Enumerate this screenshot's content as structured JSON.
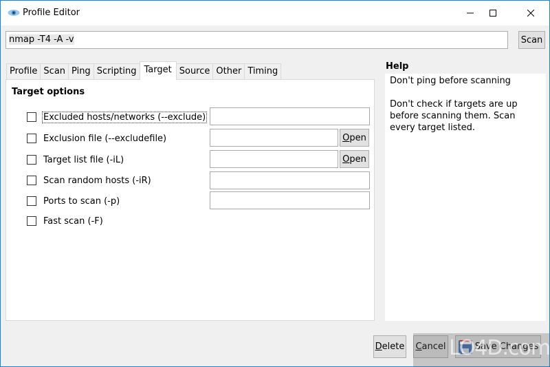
{
  "window": {
    "title": "Profile Editor",
    "controls": {
      "minimize": "minimize-icon",
      "maximize": "maximize-icon",
      "close": "close-icon"
    }
  },
  "command": {
    "value": "nmap -T4 -A -v",
    "scan_label": "Scan"
  },
  "tabs": [
    {
      "label": "Profile",
      "active": false
    },
    {
      "label": "Scan",
      "active": false
    },
    {
      "label": "Ping",
      "active": false
    },
    {
      "label": "Scripting",
      "active": false
    },
    {
      "label": "Target",
      "active": true
    },
    {
      "label": "Source",
      "active": false
    },
    {
      "label": "Other",
      "active": false
    },
    {
      "label": "Timing",
      "active": false
    }
  ],
  "target": {
    "section_title": "Target options",
    "options": [
      {
        "label": "Excluded hosts/networks (--exclude)",
        "checked": false,
        "value": ""
      },
      {
        "label": "Exclusion file (--excludefile)",
        "checked": false,
        "value": "",
        "button": "Open"
      },
      {
        "label": "Target list file (-iL)",
        "checked": false,
        "value": "",
        "button": "Open"
      },
      {
        "label": "Scan random hosts (-iR)",
        "checked": false,
        "value": ""
      },
      {
        "label": "Ports to scan (-p)",
        "checked": false,
        "value": ""
      },
      {
        "label": "Fast scan (-F)",
        "checked": false
      }
    ]
  },
  "help": {
    "title": "Help",
    "heading": "Don't ping before scanning",
    "body": "Don't check if targets are up before scanning them. Scan every target listed."
  },
  "footer": {
    "delete_label": "Delete",
    "cancel_label": "Cancel",
    "save_label": "Save Changes"
  },
  "watermark": "LO4D.com"
}
